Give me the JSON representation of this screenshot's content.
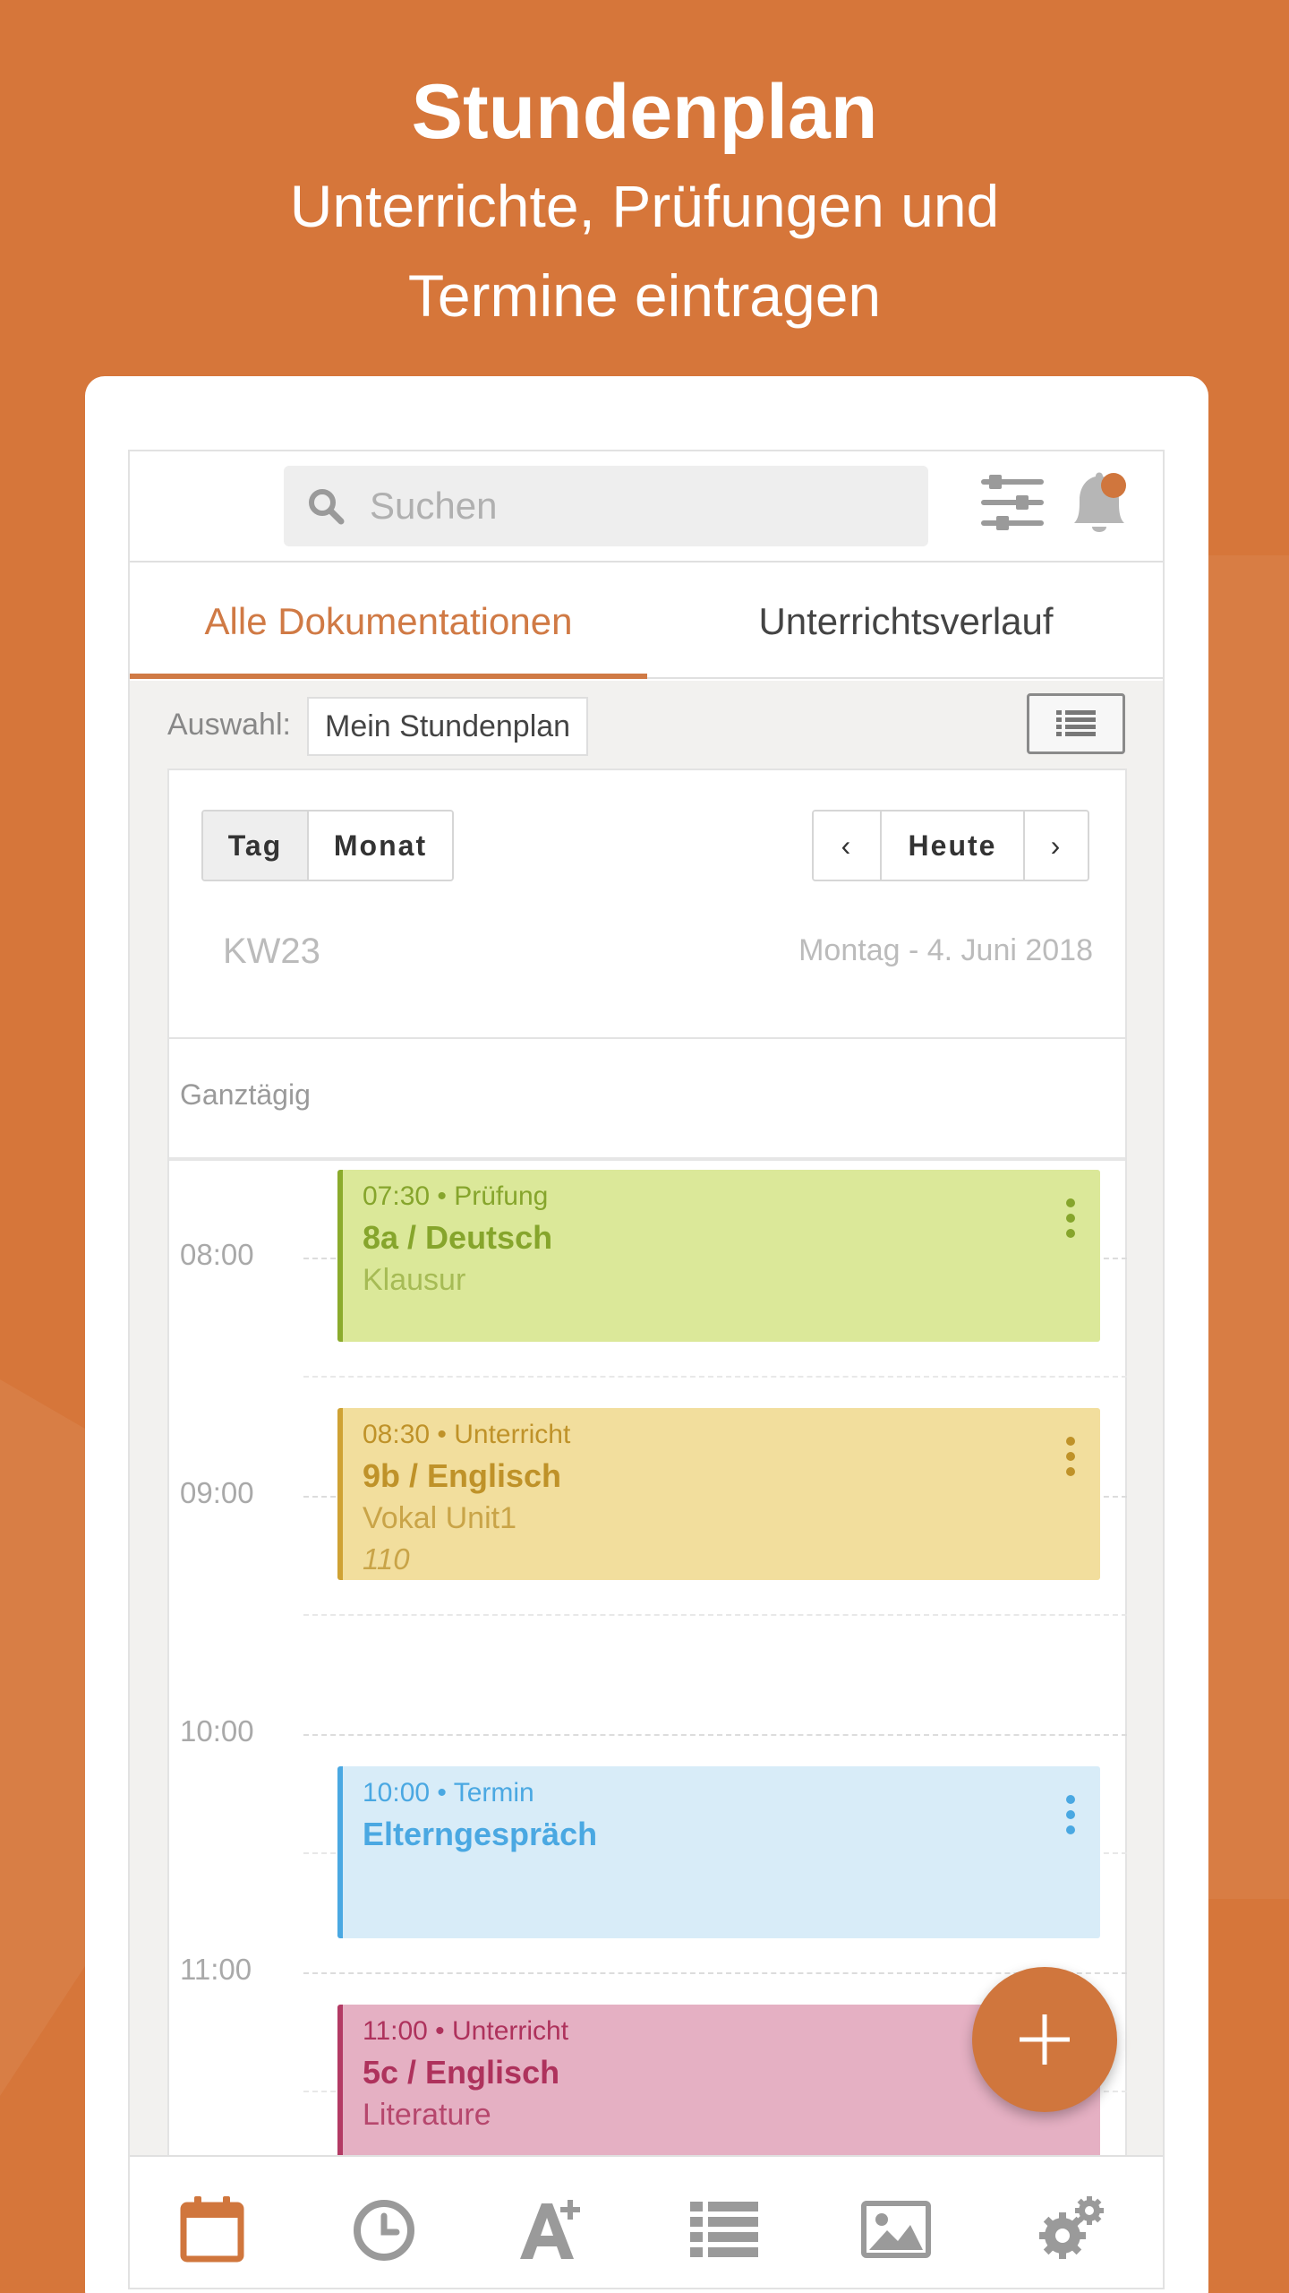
{
  "promo": {
    "title": "Stundenplan",
    "subtitle_line1": "Unterrichte, Prüfungen und",
    "subtitle_line2": "Termine eintragen"
  },
  "topbar": {
    "search_placeholder": "Suchen",
    "icons": [
      "search-icon",
      "filter-sliders-icon",
      "bell-icon"
    ],
    "notification_dot_color": "#d0763d"
  },
  "tabs": [
    {
      "label": "Alle Dokumentationen",
      "active": true
    },
    {
      "label": "Unterrichtsverlauf",
      "active": false
    }
  ],
  "selection": {
    "label": "Auswahl:",
    "value": "Mein Stundenplan"
  },
  "calendar": {
    "view_buttons": [
      {
        "label": "Tag",
        "active": true
      },
      {
        "label": "Monat",
        "active": false
      }
    ],
    "nav": {
      "prev": "‹",
      "today": "Heute",
      "next": "›"
    },
    "week": "KW23",
    "date": "Montag - 4. Juni 2018",
    "all_day_label": "Ganztägig",
    "hours": [
      "08:00",
      "09:00",
      "10:00",
      "11:00"
    ],
    "events": [
      {
        "meta": "07:30 • Prüfung",
        "title": "8a / Deutsch",
        "subtitle": "Klausur",
        "room": "",
        "bg": "#dbe899",
        "accent": "#8bab2c",
        "text": "#86a52c",
        "sub_text": "#a6bb55"
      },
      {
        "meta": "08:30 • Unterricht",
        "title": "9b / Englisch",
        "subtitle": "Vokal Unit1",
        "room": "110",
        "bg": "#f2de9d",
        "accent": "#cfa234",
        "text": "#bf9229",
        "sub_text": "#c9a448"
      },
      {
        "meta": "10:00 • Termin",
        "title": "Elterngespräch",
        "subtitle": "",
        "room": "",
        "bg": "#d8ecf8",
        "accent": "#4aa8e2",
        "text": "#4aa8e2",
        "sub_text": "#4aa8e2"
      },
      {
        "meta": "11:00 • Unterricht",
        "title": "5c / Englisch",
        "subtitle": "Literature",
        "room": "",
        "bg": "#e5b0c3",
        "accent": "#b33a64",
        "text": "#ae325c",
        "sub_text": "#b6476d"
      }
    ]
  },
  "fab": {
    "icon": "plus-icon",
    "color": "#d0763d"
  },
  "bottom_nav": [
    {
      "icon": "calendar-icon",
      "active": true
    },
    {
      "icon": "clock-icon",
      "active": false
    },
    {
      "icon": "font-plus-icon",
      "active": false
    },
    {
      "icon": "list-icon",
      "active": false
    },
    {
      "icon": "image-icon",
      "active": false
    },
    {
      "icon": "gears-icon",
      "active": false
    }
  ],
  "colors": {
    "brand": "#d6763a",
    "accent": "#d07a45",
    "nav_inactive": "#9a9a9a"
  }
}
